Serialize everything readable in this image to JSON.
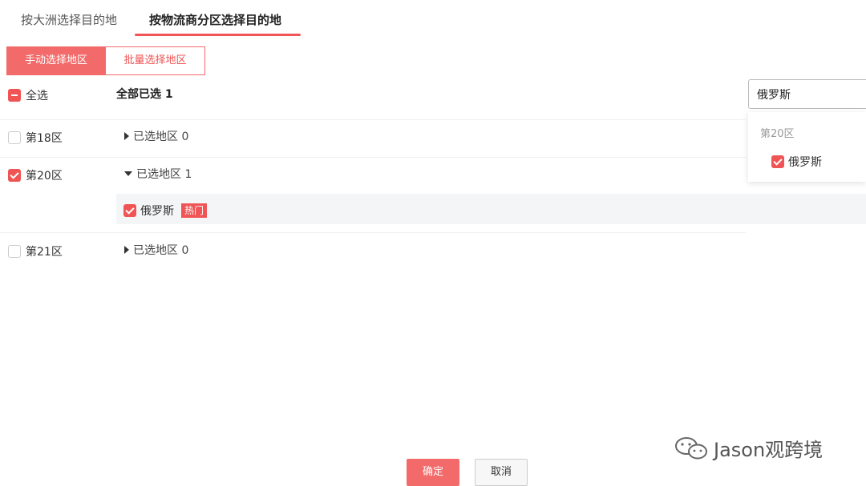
{
  "tabs": [
    {
      "label": "按大洲选择目的地",
      "active": false
    },
    {
      "label": "按物流商分区选择目的地",
      "active": true
    }
  ],
  "mode": {
    "manual_label": "手动选择地区",
    "batch_label": "批量选择地区"
  },
  "select_all": {
    "label": "全选",
    "state": "partial"
  },
  "summary": "全部已选 1",
  "zones": [
    {
      "label": "第18区",
      "checked": false,
      "expander": "已选地区 0",
      "expanded": false
    },
    {
      "label": "第20区",
      "checked": true,
      "expander": "已选地区 1",
      "expanded": true
    },
    {
      "label": "第21区",
      "checked": false,
      "expander": "已选地区 0",
      "expanded": false
    }
  ],
  "selected_country": {
    "name": "俄罗斯",
    "badge": "热门",
    "checked": true
  },
  "search": {
    "value": "俄罗斯"
  },
  "dropdown": {
    "group": "第20区",
    "item": "俄罗斯"
  },
  "footer": {
    "ok_label": "确定",
    "cancel_label": "取消"
  },
  "watermark": {
    "text": "Jason观跨境"
  },
  "colors": {
    "accent": "#f05454",
    "accent_light": "#f36a6a"
  }
}
